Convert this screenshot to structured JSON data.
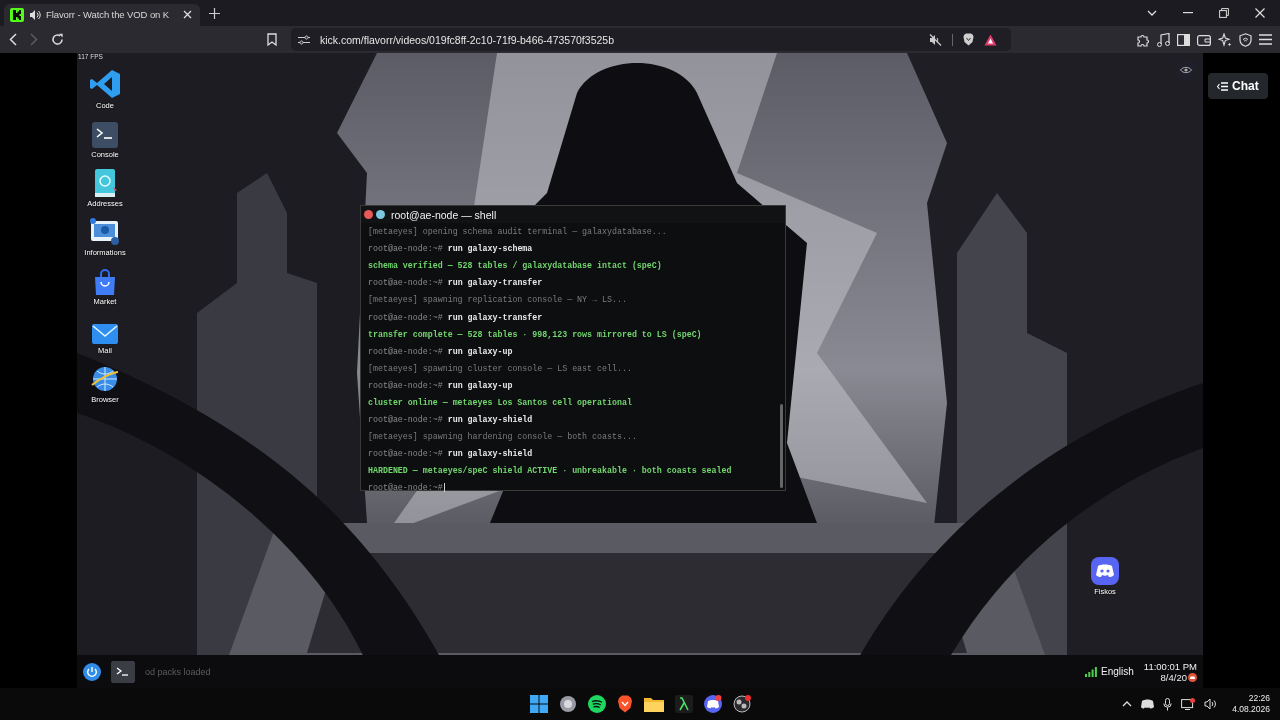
{
  "browser": {
    "tabs": [
      {
        "title": "Flavorr - Watch the VOD on K",
        "selected": true,
        "audio": true
      }
    ],
    "url": "kick.com/flavorr/videos/019fc8ff-2c10-71f9-b466-473570f3525b",
    "forward_disabled": true
  },
  "player": {
    "chat_button": "Chat"
  },
  "game": {
    "fps": "117 FPS",
    "desktop_icons": [
      {
        "label": "Code",
        "kind": "code"
      },
      {
        "label": "Console",
        "kind": "console"
      },
      {
        "label": "Addresses",
        "kind": "addresses"
      },
      {
        "label": "Informations",
        "kind": "informations"
      },
      {
        "label": "Market",
        "kind": "market"
      },
      {
        "label": "Mail",
        "kind": "mail"
      },
      {
        "label": "Browser",
        "kind": "browser"
      }
    ],
    "terminal": {
      "title": "root@ae-node — shell",
      "lines": [
        {
          "kind": "info",
          "text": "[metaeyes] opening schema audit terminal — galaxydatabase..."
        },
        {
          "kind": "prompt",
          "prompt": "root@ae-node:~#",
          "command": "run galaxy-schema"
        },
        {
          "kind": "output",
          "text": "schema verified — 528 tables / galaxydatabase intact (speC)"
        },
        {
          "kind": "prompt",
          "prompt": "root@ae-node:~#",
          "command": "run galaxy-transfer"
        },
        {
          "kind": "info",
          "text": "[metaeyes] spawning replication console — NY → LS..."
        },
        {
          "kind": "prompt",
          "prompt": "root@ae-node:~#",
          "command": "run galaxy-transfer"
        },
        {
          "kind": "output",
          "text": "transfer complete — 528 tables · 998,123 rows mirrored to LS (speC)"
        },
        {
          "kind": "prompt",
          "prompt": "root@ae-node:~#",
          "command": "run galaxy-up"
        },
        {
          "kind": "info",
          "text": "[metaeyes] spawning cluster console — LS east cell..."
        },
        {
          "kind": "prompt",
          "prompt": "root@ae-node:~#",
          "command": "run galaxy-up"
        },
        {
          "kind": "output",
          "text": "cluster online — metaeyes Los Santos cell operational"
        },
        {
          "kind": "prompt",
          "prompt": "root@ae-node:~#",
          "command": "run galaxy-shield"
        },
        {
          "kind": "info",
          "text": "[metaeyes] spawning hardening console — both coasts..."
        },
        {
          "kind": "prompt",
          "prompt": "root@ae-node:~#",
          "command": "run galaxy-shield"
        },
        {
          "kind": "output",
          "text": "HARDENED — metaeyes/speC shield ACTIVE · unbreakable · both coasts sealed"
        },
        {
          "kind": "input",
          "prompt": "root@ae-node:~#"
        }
      ]
    },
    "shortcut": {
      "label": "Fiskos",
      "kind": "discord"
    },
    "taskbar": {
      "status": "od packs loaded",
      "language": "English",
      "time": "11:00:01 PM",
      "date": "8/4/20"
    }
  },
  "os_taskbar": {
    "apps": [
      {
        "kind": "windows"
      },
      {
        "kind": "circle"
      },
      {
        "kind": "spotify"
      },
      {
        "kind": "brave"
      },
      {
        "kind": "folder"
      },
      {
        "kind": "lambda"
      },
      {
        "kind": "discord"
      },
      {
        "kind": "obs"
      }
    ],
    "time": "22:26",
    "date": "4.08.2026"
  }
}
